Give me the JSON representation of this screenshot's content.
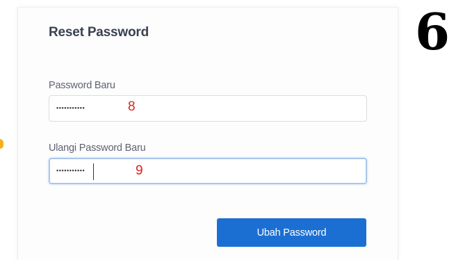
{
  "step_label": "6",
  "form": {
    "title": "Reset Password",
    "new_password": {
      "label": "Password Baru",
      "value_masked": "•••••••••••",
      "annotation": "8"
    },
    "repeat_password": {
      "label": "Ulangi Password Baru",
      "value_masked": "•••••••••••",
      "annotation": "9"
    },
    "submit_label": "Ubah Password"
  },
  "colors": {
    "primary_button": "#1b6fd3",
    "annotation": "#e0201c",
    "focus_border": "#a9c8ea"
  }
}
